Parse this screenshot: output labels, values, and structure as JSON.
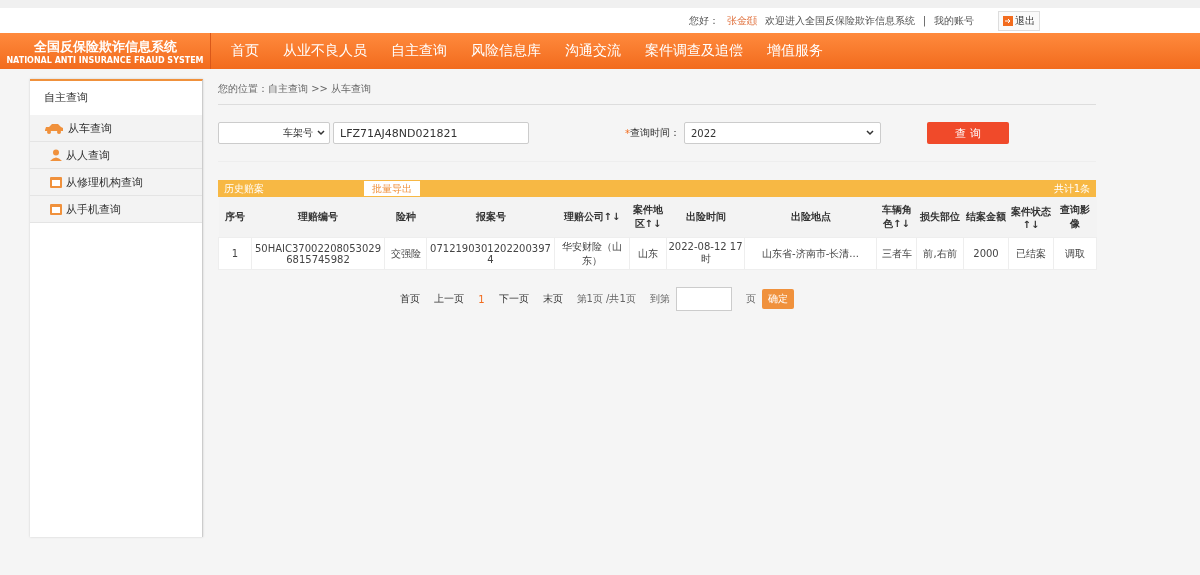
{
  "top_bar": {
    "greeting": "您好：",
    "user": "张金颋",
    "welcome": "欢迎进入全国反保险欺诈信息系统",
    "separator": "|",
    "account": "我的账号",
    "logout": "退出"
  },
  "brand": {
    "title": "全国反保险欺诈信息系统",
    "subtitle": "NATIONAL ANTI INSURANCE FRAUD SYSTEM"
  },
  "nav": [
    "首页",
    "从业不良人员",
    "自主查询",
    "风险信息库",
    "沟通交流",
    "案件调查及追偿",
    "增值服务"
  ],
  "sidebar": {
    "title": "自主查询",
    "items": [
      {
        "label": "从车查询",
        "kind": "car"
      },
      {
        "label": "从人查询",
        "kind": "person"
      },
      {
        "label": "从修理机构查询",
        "kind": "calendar"
      },
      {
        "label": "从手机查询",
        "kind": "calendar"
      }
    ]
  },
  "breadcrumb": "您的位置：自主查询 >> 从车查询",
  "search": {
    "required": "*",
    "type_select": "车架号",
    "value": "LFZ71AJ48ND021821",
    "time_label": "查询时间：",
    "time_value": "2022",
    "button": "查 询"
  },
  "table": {
    "title": "历史赔案",
    "export": "批量导出",
    "total": "共计1条",
    "columns": [
      "序号",
      "理赔编号",
      "险种",
      "报案号",
      "理赔公司↑↓",
      "案件地区↑↓",
      "出险时间",
      "出险地点",
      "车辆角色↑↓",
      "损失部位",
      "结案金额",
      "案件状态↑↓",
      "查询影像"
    ],
    "rows": [
      [
        "1",
        "50HAIC370022080530296815745982",
        "交强险",
        "07121903012022003974",
        "华安财险（山东）",
        "山东",
        "2022-08-12 17时",
        "山东省-济南市-长清...",
        "三者车",
        "前,右前",
        "2000",
        "已结案",
        "调取"
      ]
    ]
  },
  "pager": {
    "first": "首页",
    "prev": "上一页",
    "current": "1",
    "next": "下一页",
    "last": "末页",
    "info": "第1页 /共1页",
    "goto": "到第",
    "page": "页",
    "confirm": "确定"
  }
}
